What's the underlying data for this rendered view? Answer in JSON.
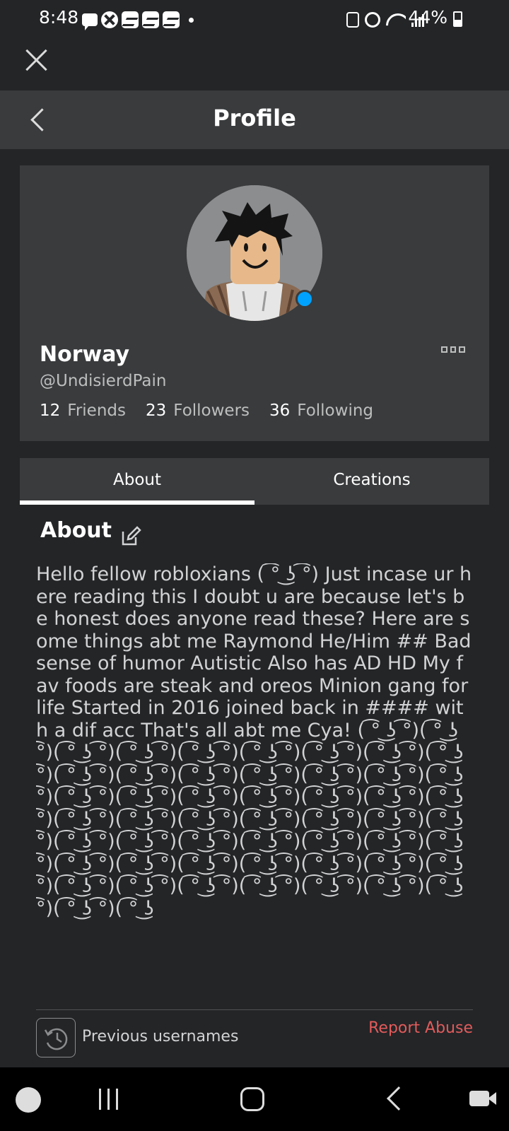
{
  "status_bar": {
    "time": "8:48",
    "battery": "44%"
  },
  "header": {
    "title": "Profile"
  },
  "profile": {
    "display_name": "Norway",
    "username": "@UndisierdPain",
    "friends_count": "12",
    "friends_label": "Friends",
    "followers_count": "23",
    "followers_label": "Followers",
    "following_count": "36",
    "following_label": "Following",
    "online_color": "#00a2ff"
  },
  "tabs": [
    {
      "label": "About",
      "active": true
    },
    {
      "label": "Creations",
      "active": false
    }
  ],
  "about": {
    "heading": "About",
    "text": "Hello fellow robloxians ( ͡° ͜ʖ ͡°) Just incase ur here reading this I doubt u are because let's be honest does anyone read these? Here are some things abt me Raymond He/Him ## Bad sense of humor Autistic Also has AD HD My fav foods are steak and oreos Minion gang for life Started in 2016 joined back in #### with a dif acc That's all abt me Cya! ( ͡° ͜ʖ ͡°)( ͡° ͜ʖ ͡°)( ͡° ͜ʖ ͡°)( ͡° ͜ʖ ͡°)( ͡° ͜ʖ ͡°)( ͡° ͜ʖ ͡°)( ͡° ͜ʖ ͡°)( ͡° ͜ʖ ͡°)( ͡° ͜ʖ ͡°)( ͡° ͜ʖ ͡°)( ͡° ͜ʖ ͡°)( ͡° ͜ʖ ͡°)( ͡° ͜ʖ ͡°)( ͡° ͜ʖ ͡°)( ͡° ͜ʖ ͡°)( ͡° ͜ʖ ͡°)( ͡° ͜ʖ ͡°)( ͡° ͜ʖ ͡°)( ͡° ͜ʖ ͡°)( ͡° ͜ʖ ͡°)( ͡° ͜ʖ ͡°)( ͡° ͜ʖ ͡°)( ͡° ͜ʖ ͡°)( ͡° ͜ʖ ͡°)( ͡° ͜ʖ ͡°)( ͡° ͜ʖ ͡°)( ͡° ͜ʖ ͡°)( ͡° ͜ʖ ͡°)( ͡° ͜ʖ ͡°)( ͡° ͜ʖ ͡°)( ͡° ͜ʖ ͡°)( ͡° ͜ʖ ͡°)( ͡° ͜ʖ ͡°)( ͡° ͜ʖ ͡°)( ͡° ͜ʖ ͡°)( ͡° ͜ʖ ͡°)( ͡° ͜ʖ ͡°)( ͡° ͜ʖ ͡°)( ͡° ͜ʖ ͡°)( ͡° ͜ʖ ͡°)( ͡° ͜ʖ ͡°)( ͡° ͜ʖ ͡°)( ͡° ͜ʖ ͡°)( ͡° ͜ʖ ͡°)( ͡° ͜ʖ ͡°)( ͡° ͜ʖ ͡°)( ͡° ͜ʖ ͡°)( ͡° ͜ʖ ͡°)( ͡° ͜ʖ ͡°)( ͡° ͜ʖ ͡°)( ͡° ͜ʖ ͡°)( ͡° ͜ʖ ͡°)( ͡° ͜ʖ"
  },
  "footer": {
    "previous_usernames_label": "Previous usernames",
    "report_label": "Report Abuse",
    "report_color": "#e25b5b"
  },
  "icons": {
    "close": "close-icon",
    "back": "chevron-left-icon",
    "more": "more-options-icon",
    "edit": "edit-icon",
    "history": "history-icon"
  }
}
